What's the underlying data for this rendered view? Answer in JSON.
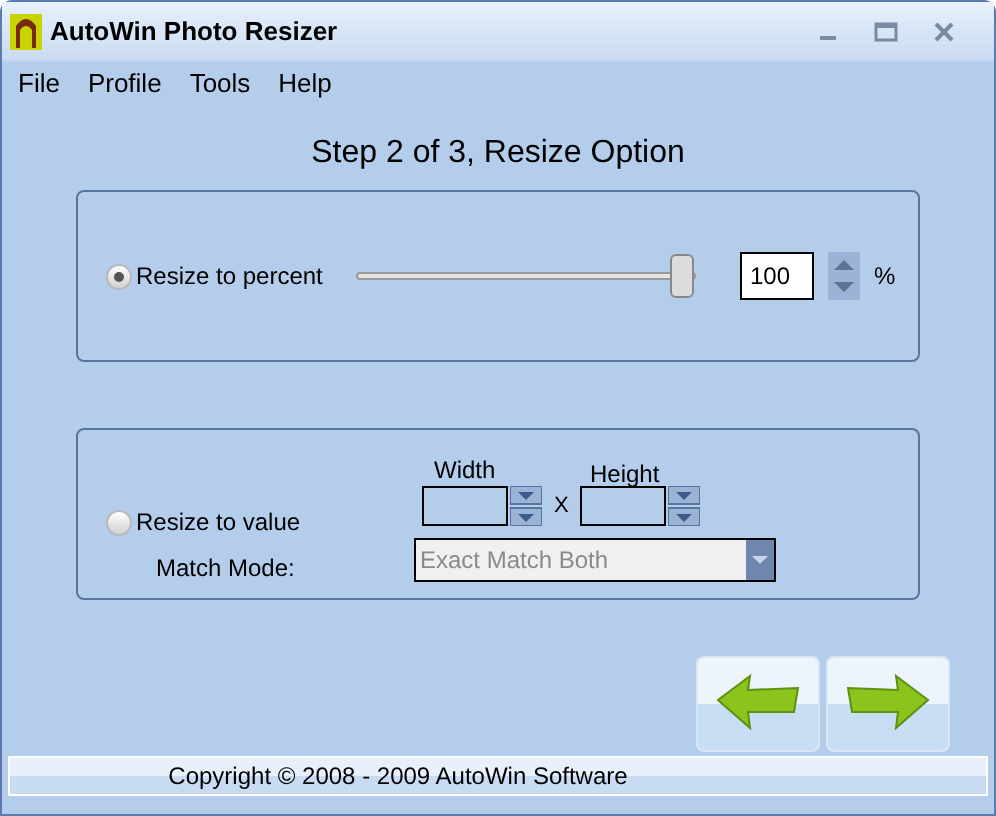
{
  "window": {
    "title": "AutoWin Photo Resizer"
  },
  "menu": [
    "File",
    "Profile",
    "Tools",
    "Help"
  ],
  "heading": "Step 2 of 3, Resize Option",
  "percent_option": {
    "label": "Resize to percent",
    "selected": true,
    "level": 1.0,
    "value": "100",
    "unit": "%"
  },
  "value_option": {
    "label": "Resize to value",
    "selected": false,
    "width_label": "Width",
    "height_label": "Height",
    "separator": "X",
    "match_mode_label": "Match Mode:",
    "match_mode": "Exact Match Both",
    "disabled": true
  },
  "status_bar": "Copyright © 2008 - 2009 AutoWin Software"
}
